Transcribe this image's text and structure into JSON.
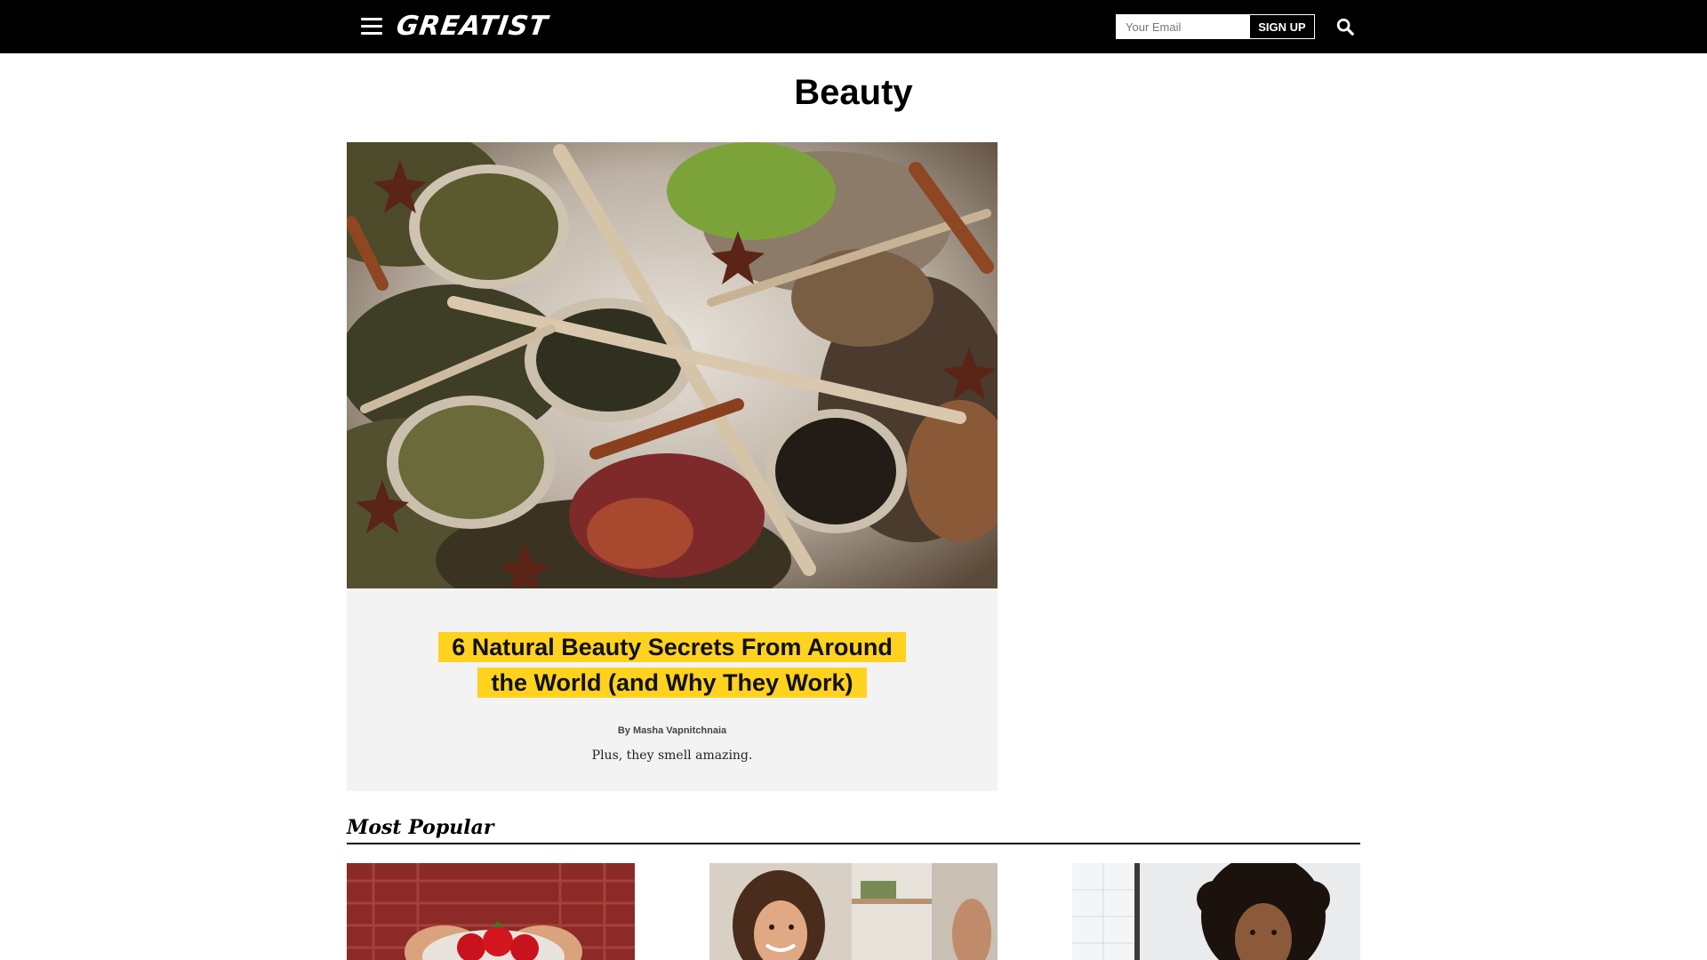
{
  "header": {
    "logo_text": "GREATIST",
    "email_placeholder": "Your Email",
    "signup_label": "SIGN UP",
    "menu_icon": "hamburger-menu-icon",
    "search_icon": "search-icon"
  },
  "page": {
    "title": "Beauty"
  },
  "featured": {
    "headline_line1": "6 Natural Beauty Secrets From Around",
    "headline_line2": "the World (and Why They Work)",
    "byline": "By Masha Vapnitchnaia",
    "dek": "Plus, they smell amazing.",
    "highlight_color": "#ffd21f"
  },
  "most_popular": {
    "heading": "Most Popular",
    "cards": [
      {
        "image": "strawberries-in-hands-photo"
      },
      {
        "image": "smiling-woman-at-mirror-photo"
      },
      {
        "image": "woman-curly-hair-bathroom-photo"
      }
    ]
  },
  "colors": {
    "topbar_bg": "#000000",
    "card_bg": "#f3f3f3",
    "accent_yellow": "#ffd21f"
  }
}
